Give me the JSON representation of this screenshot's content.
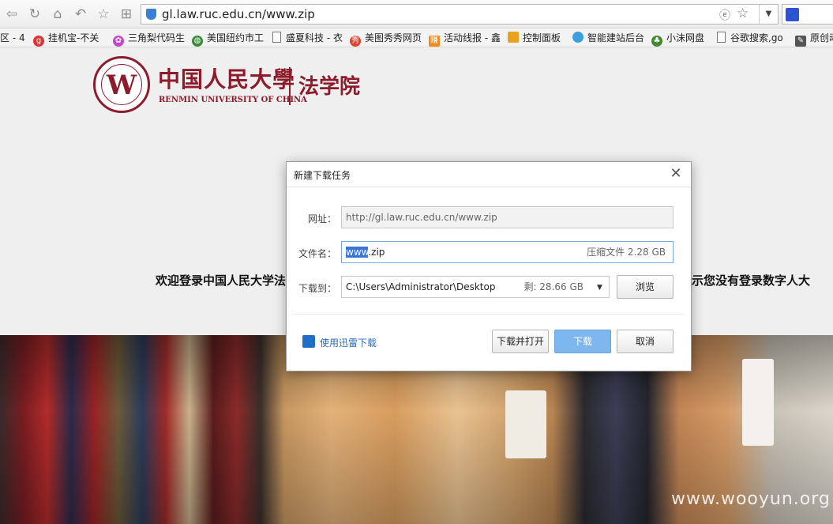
{
  "browser": {
    "url": "gl.law.ruc.edu.cn/www.zip",
    "icons": [
      "back-icon",
      "refresh-icon",
      "home-icon",
      "undo-icon",
      "star-icon",
      "apps-icon"
    ]
  },
  "bookmarks": [
    {
      "label": "区 - 4"
    },
    {
      "label": "挂机宝-不关"
    },
    {
      "label": "三角梨代码生"
    },
    {
      "label": "美国纽约市工"
    },
    {
      "label": "盛夏科技 - 衣"
    },
    {
      "label": "美图秀秀网页"
    },
    {
      "label": "活动线报 - 鑫"
    },
    {
      "label": "控制面板"
    },
    {
      "label": "智能建站后台"
    },
    {
      "label": "小沫网盘"
    },
    {
      "label": "谷歌搜索,go"
    },
    {
      "label": "原创动"
    }
  ],
  "page": {
    "logo_cn": "中国人民大學",
    "logo_en": "RENMIN UNIVERSITY OF CHINA",
    "logo_school": "法学院",
    "welcome_left": "欢迎登录中国人民大学法",
    "welcome_right": "示您没有登录数字人大",
    "watermark": "www.wooyun.org"
  },
  "dialog": {
    "title": "新建下载任务",
    "url_label": "网址：",
    "url_value": "http://gl.law.ruc.edu.cn/www.zip",
    "filename_label": "文件名：",
    "filename_selected": "www",
    "filename_rest": ".zip",
    "filename_meta": "压缩文件 2.28 GB",
    "saveto_label": "下载到：",
    "saveto_value": "C:\\Users\\Administrator\\Desktop",
    "saveto_meta": "剩: 28.66 GB",
    "browse_button": "浏览",
    "xunlei_link": "使用迅雷下载",
    "download_open_button": "下载并打开",
    "download_button": "下载",
    "cancel_button": "取消"
  }
}
